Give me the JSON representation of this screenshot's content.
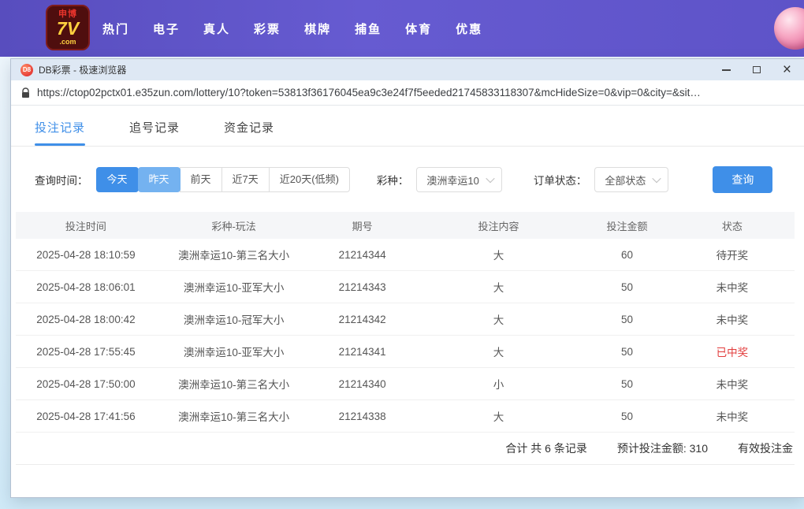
{
  "site_header": {
    "logo": {
      "top": "申博",
      "main": "7V",
      "sub": ".com"
    },
    "nav": [
      "热门",
      "电子",
      "真人",
      "彩票",
      "棋牌",
      "捕鱼",
      "体育",
      "优惠"
    ]
  },
  "browser": {
    "icon_text": "D8",
    "title": "DB彩票 - 极速浏览器",
    "url": "https://ctop02pctx01.e35zun.com/lottery/10?token=53813f36176045ea9c3e24f7f5eeded21745833118307&mcHideSize=0&vip=0&city=&sit…"
  },
  "icons": {
    "close_glyph": "×"
  },
  "tabs": [
    {
      "label": "投注记录",
      "state": "active"
    },
    {
      "label": "追号记录",
      "state": ""
    },
    {
      "label": "资金记录",
      "state": ""
    }
  ],
  "filters": {
    "time_label": "查询时间：",
    "time_options": [
      {
        "label": "今天",
        "state": "active"
      },
      {
        "label": "昨天",
        "state": "active-light"
      },
      {
        "label": "前天",
        "state": ""
      },
      {
        "label": "近7天",
        "state": ""
      },
      {
        "label": "近20天(低频)",
        "state": ""
      }
    ],
    "lottery_label": "彩种：",
    "lottery_value": "澳洲幸运10",
    "status_label": "订单状态：",
    "status_value": "全部状态",
    "search_button": "查询"
  },
  "table": {
    "headers": [
      "投注时间",
      "彩种-玩法",
      "期号",
      "投注内容",
      "投注金额",
      "状态"
    ],
    "rows": [
      {
        "time": "2025-04-28 18:10:59",
        "game": "澳洲幸运10-第三名大小",
        "issue": "21214344",
        "content": "大",
        "amount": "60",
        "status": "待开奖",
        "status_color": "normal"
      },
      {
        "time": "2025-04-28 18:06:01",
        "game": "澳洲幸运10-亚军大小",
        "issue": "21214343",
        "content": "大",
        "amount": "50",
        "status": "未中奖",
        "status_color": "normal"
      },
      {
        "time": "2025-04-28 18:00:42",
        "game": "澳洲幸运10-冠军大小",
        "issue": "21214342",
        "content": "大",
        "amount": "50",
        "status": "未中奖",
        "status_color": "normal"
      },
      {
        "time": "2025-04-28 17:55:45",
        "game": "澳洲幸运10-亚军大小",
        "issue": "21214341",
        "content": "大",
        "amount": "50",
        "status": "已中奖",
        "status_color": "red"
      },
      {
        "time": "2025-04-28 17:50:00",
        "game": "澳洲幸运10-第三名大小",
        "issue": "21214340",
        "content": "小",
        "amount": "50",
        "status": "未中奖",
        "status_color": "normal"
      },
      {
        "time": "2025-04-28 17:41:56",
        "game": "澳洲幸运10-第三名大小",
        "issue": "21214338",
        "content": "大",
        "amount": "50",
        "status": "未中奖",
        "status_color": "normal"
      }
    ],
    "summary": {
      "total": "合计 共 6 条记录",
      "expected": "预计投注金额: 310",
      "valid": "有效投注金"
    }
  }
}
